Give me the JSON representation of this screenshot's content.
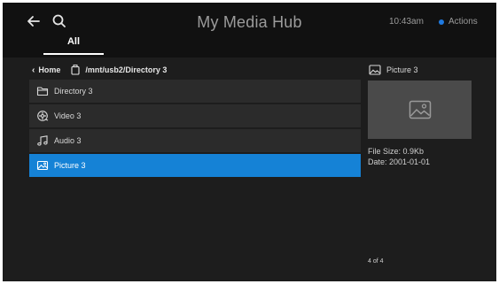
{
  "header": {
    "title": "My Media Hub",
    "tab_all": "All",
    "time": "10:43am",
    "actions_label": "Actions",
    "back_icon": "back-arrow-icon",
    "search_icon": "search-icon",
    "accent": "#1f7ae0"
  },
  "breadcrumb": {
    "home": "Home",
    "path": "/mnt/usb2/Directory 3",
    "home_icon": "chevron-left-icon",
    "drive_icon": "usb-drive-icon"
  },
  "files": [
    {
      "label": "Directory 3",
      "icon": "folder-icon",
      "selected": false
    },
    {
      "label": "Video 3",
      "icon": "video-icon",
      "selected": false
    },
    {
      "label": "Audio 3",
      "icon": "music-note-icon",
      "selected": false
    },
    {
      "label": "Picture 3",
      "icon": "picture-icon",
      "selected": true
    }
  ],
  "preview": {
    "title": "Picture 3",
    "file_size": "File Size: 0.9Kb",
    "date": "Date: 2001-01-01",
    "page_count": "4 of 4"
  },
  "colors": {
    "selected_row": "#1582d6",
    "row": "#2b2b2b",
    "background": "#1d1d1d",
    "header": "#111111"
  }
}
